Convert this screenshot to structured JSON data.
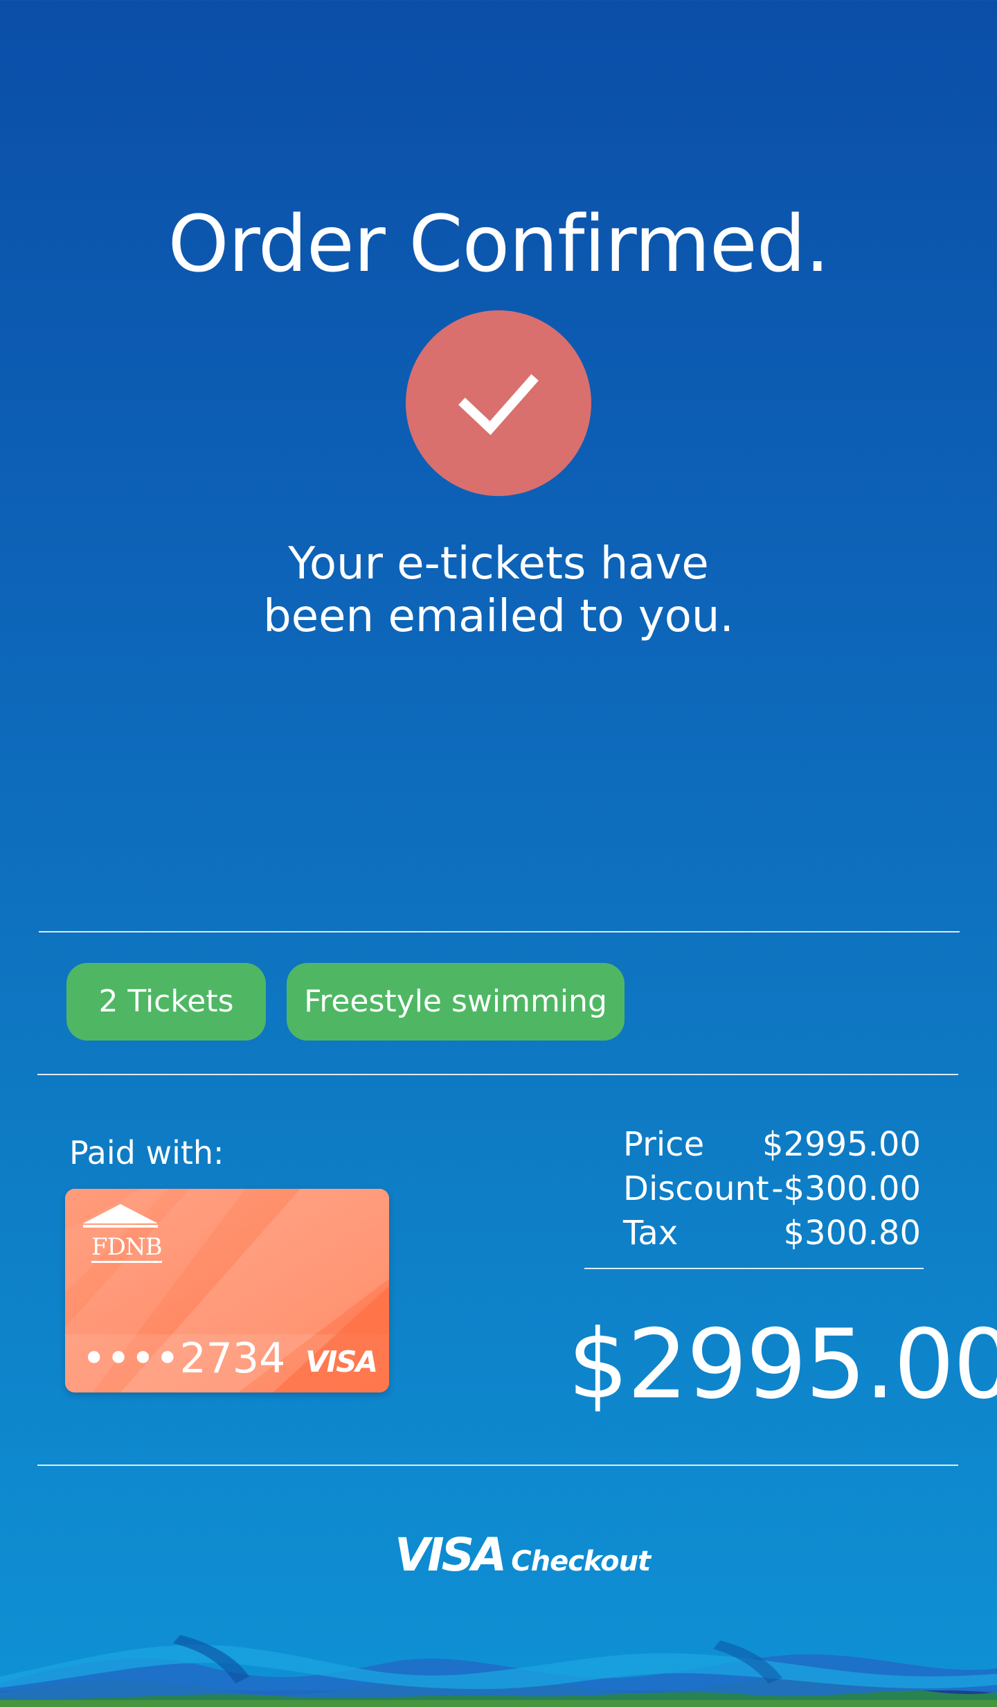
{
  "header": {
    "title": "Order Confirmed.",
    "status_icon": "checkmark-icon",
    "message_line1": "Your e-tickets have",
    "message_line2": "been emailed to you."
  },
  "order": {
    "tags": [
      "2 Tickets",
      "Freestyle swimming"
    ]
  },
  "payment": {
    "paid_with_label": "Paid with:",
    "card": {
      "bank_name": "FDNB",
      "masked_number": "••••2734",
      "network": "VISA",
      "color": "#ff8a66"
    }
  },
  "summary": {
    "rows": [
      {
        "label": "Price",
        "value": "$2995.00"
      },
      {
        "label": "Discount",
        "value": "-$300.00"
      },
      {
        "label": "Tax",
        "value": "$300.80"
      }
    ],
    "total": "$2995.00"
  },
  "footer": {
    "brand_primary": "VISA",
    "brand_secondary": "Checkout"
  },
  "colors": {
    "background_top": "#0b4ea8",
    "background_bottom": "#0f91d5",
    "check_circle": "#d9706e",
    "pill": "#4fb764"
  }
}
